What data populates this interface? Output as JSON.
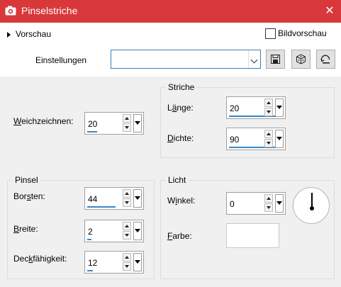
{
  "window": {
    "title": "Pinselstriche"
  },
  "top": {
    "preview_label": "Vorschau",
    "bild_label": "Bildvorschau",
    "settings_label": "Einstellungen",
    "settings_value": ""
  },
  "weich": {
    "label_u": "W",
    "label_rest": "eichzeichnen:",
    "value": "20"
  },
  "striche": {
    "title": "Striche",
    "laenge": {
      "label_a": "L",
      "label_u": "ä",
      "label_b": "nge:",
      "value": "20"
    },
    "dichte": {
      "label_u": "D",
      "label_rest": "ichte:",
      "value": "90"
    }
  },
  "pinsel": {
    "title": "Pinsel",
    "borsten": {
      "label_a": "Bor",
      "label_u": "s",
      "label_b": "ten:",
      "value": "44"
    },
    "breite": {
      "label_u": "B",
      "label_rest": "reite:",
      "value": "2"
    },
    "deck": {
      "label_a": "Dec",
      "label_u": "k",
      "label_b": "fähigkeit:",
      "value": "12"
    }
  },
  "licht": {
    "title": "Licht",
    "winkel": {
      "label_a": "W",
      "label_u": "i",
      "label_b": "nkel:",
      "value": "0"
    },
    "farbe": {
      "label_u": "F",
      "label_rest": "arbe:"
    }
  }
}
